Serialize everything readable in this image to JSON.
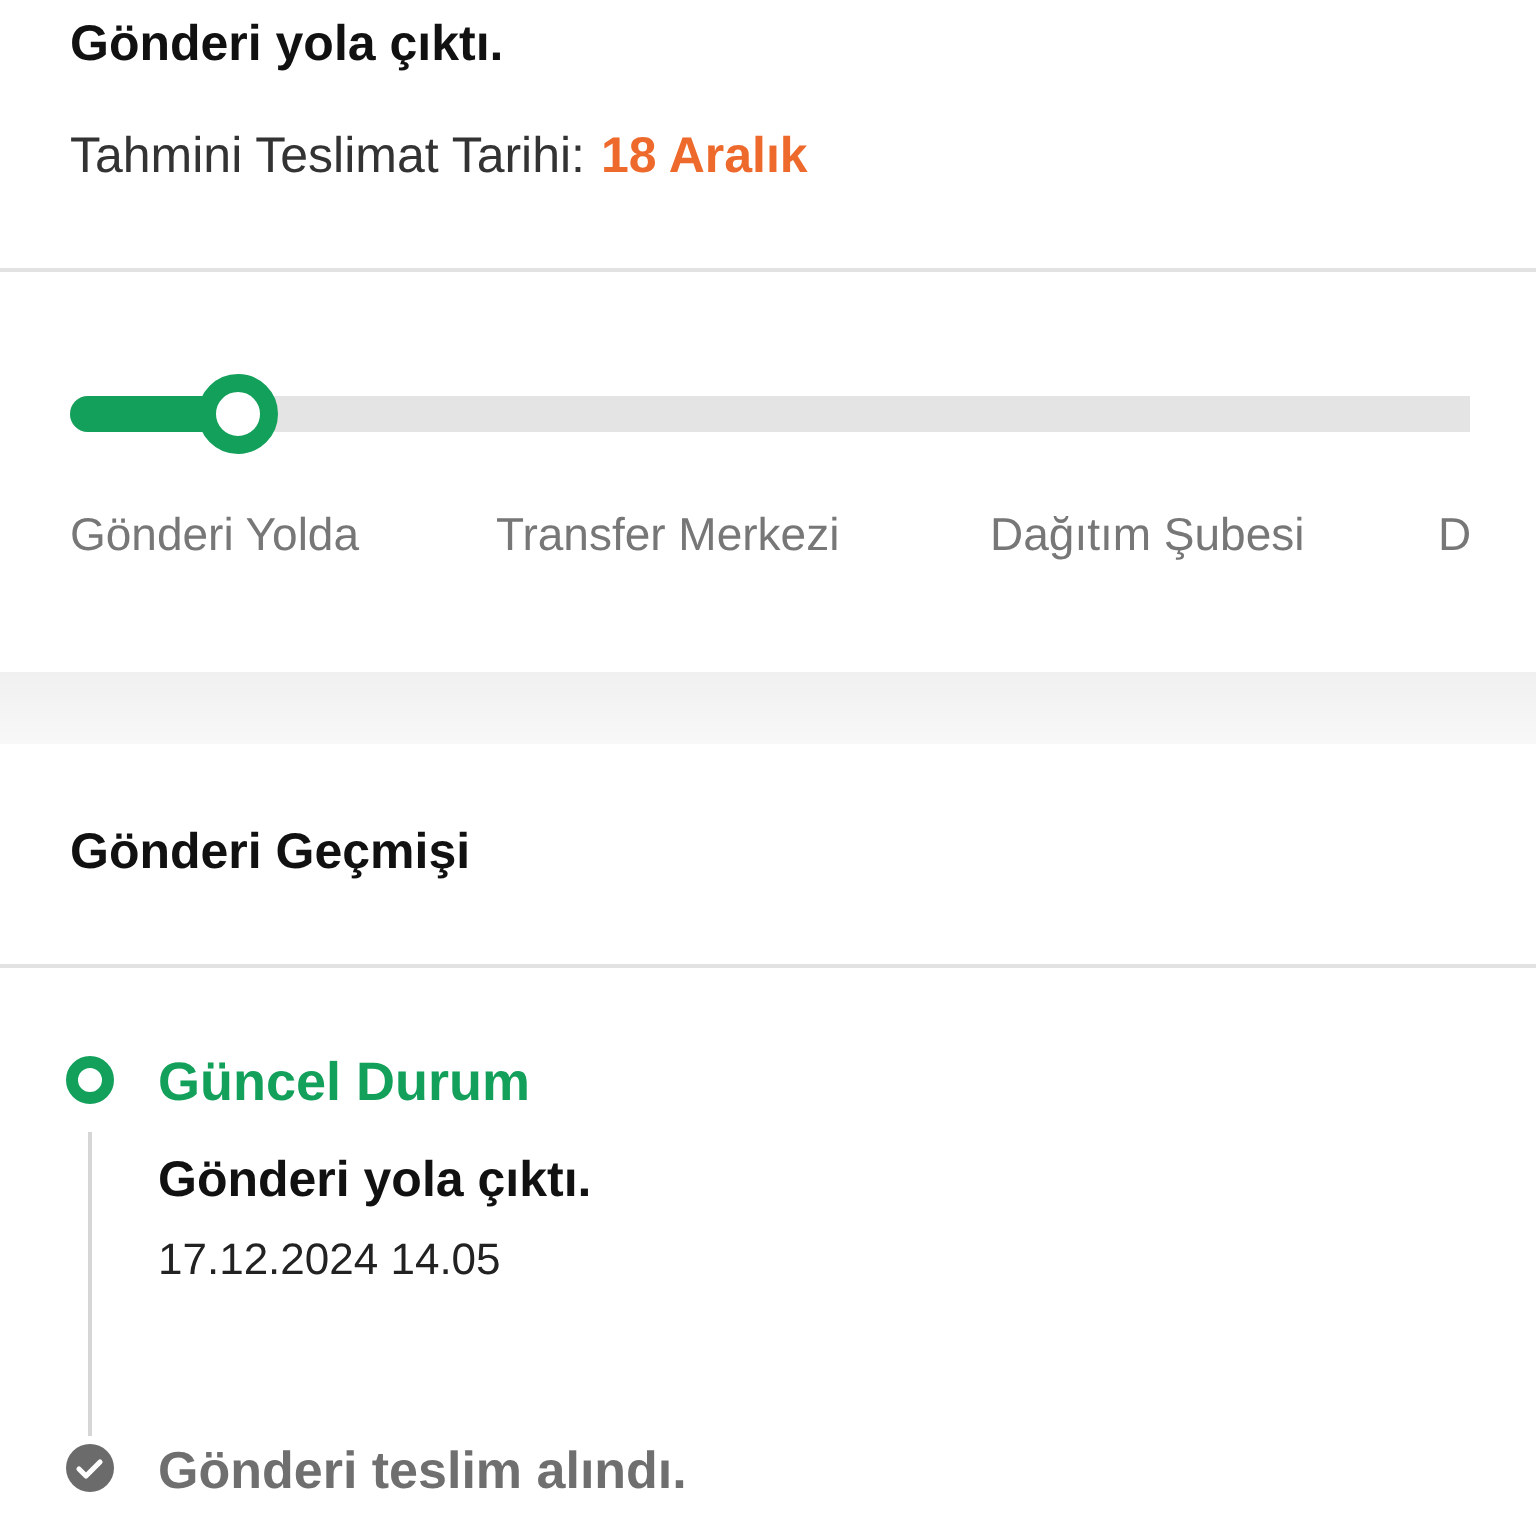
{
  "header": {
    "title": "Gönderi yola çıktı.",
    "estimate_label": "Tahmini Teslimat Tarihi:",
    "estimate_value": "18 Aralık"
  },
  "progress": {
    "level": 0.12,
    "steps": [
      "Gönderi Yolda",
      "Transfer Merkezi",
      "Dağıtım Şubesi",
      "D"
    ]
  },
  "history": {
    "title": "Gönderi Geçmişi",
    "events": [
      {
        "kind": "current",
        "label": "Güncel Durum",
        "title": "Gönderi yola çıktı.",
        "time": "17.12.2024 14.05"
      },
      {
        "kind": "done",
        "title": "Gönderi teslim alındı."
      }
    ]
  }
}
